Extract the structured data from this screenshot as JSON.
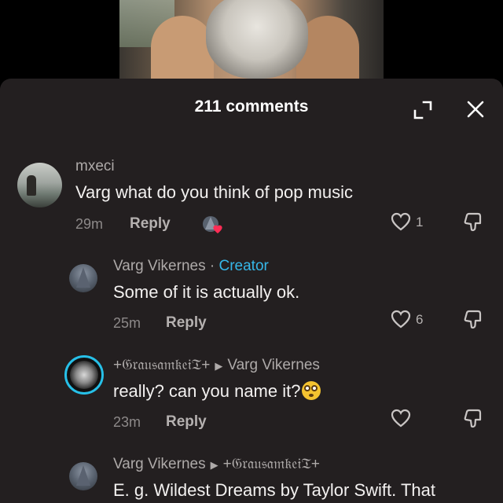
{
  "header": {
    "title": "211 comments"
  },
  "comments": [
    {
      "username": "mxeci",
      "text": "Varg what do you think of pop music",
      "time": "29m",
      "reply_label": "Reply",
      "likes": "1"
    },
    {
      "username": "Varg Vikernes",
      "separator": " · ",
      "badge": "Creator",
      "text": "Some of it is actually ok.",
      "time": "25m",
      "reply_label": "Reply",
      "likes": "6"
    },
    {
      "username": "+𝔊𝔯𝔞𝔲𝔰𝔞𝔪𝔨𝔢𝔦𝔗+",
      "reply_to": "Varg Vikernes",
      "text": "really? can you name it?",
      "time": "23m",
      "reply_label": "Reply",
      "likes": ""
    },
    {
      "username": "Varg Vikernes",
      "reply_to": "+𝔊𝔯𝔞𝔲𝔰𝔞𝔪𝔨𝔢𝔦𝔗+",
      "text": "E. g. Wildest Dreams by Taylor Swift. That"
    }
  ],
  "colors": {
    "sheet": "#231f20",
    "creator": "#36b7e8",
    "heart": "#fe2c55"
  },
  "icons": [
    "expand-icon",
    "close-icon",
    "heart-outline-icon",
    "dislike-icon",
    "liked-by-creator-icon",
    "flushed-face-emoji"
  ]
}
